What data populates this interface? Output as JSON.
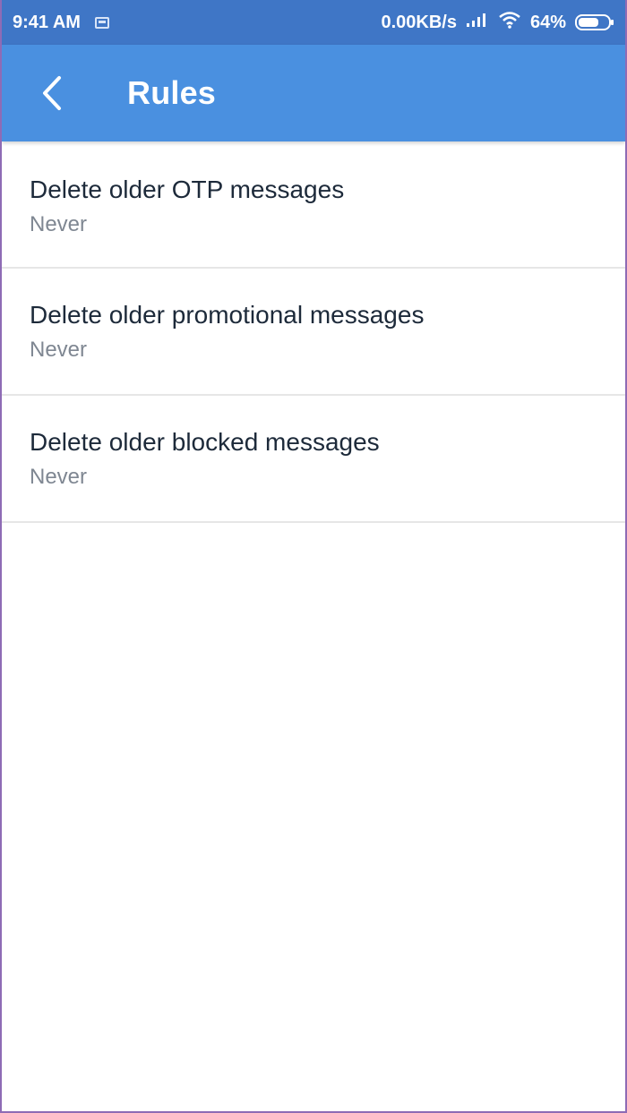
{
  "status_bar": {
    "time": "9:41 AM",
    "network_speed": "0.00KB/s",
    "battery_percent": "64%",
    "icons": [
      "notification-icon",
      "signal-icon",
      "wifi-icon",
      "battery-icon"
    ]
  },
  "app_bar": {
    "title": "Rules",
    "back_icon": "back-arrow-icon",
    "color": "#4a90e0"
  },
  "rules": [
    {
      "title": "Delete older OTP messages",
      "value": "Never"
    },
    {
      "title": "Delete older promotional messages",
      "value": "Never"
    },
    {
      "title": "Delete older blocked messages",
      "value": "Never"
    }
  ]
}
